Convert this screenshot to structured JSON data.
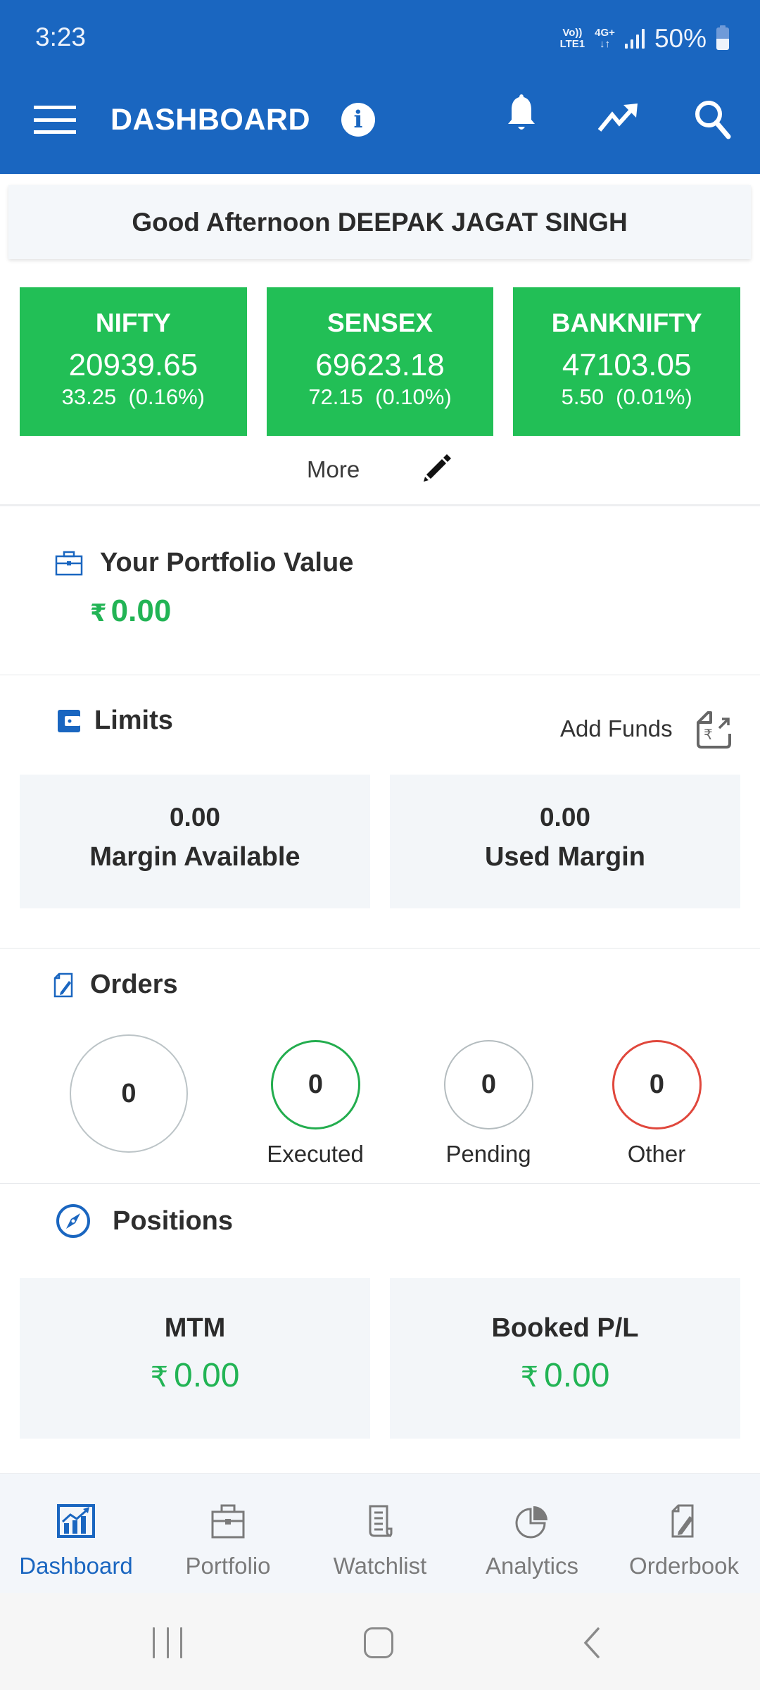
{
  "status_bar": {
    "time": "3:23",
    "net_top_left": "Vo))",
    "net_bottom_left": "LTE1",
    "net_top_right": "4G+",
    "net_bottom_right": "↓↑",
    "battery": "50%"
  },
  "app_bar": {
    "title": "DASHBOARD",
    "info_glyph": "i",
    "icons": [
      "menu-icon",
      "info-icon",
      "bell-icon",
      "trending-up-icon",
      "search-icon"
    ]
  },
  "greeting": "Good Afternoon DEEPAK JAGAT SINGH",
  "indices": [
    {
      "name": "NIFTY",
      "value": "20939.65",
      "change": "33.25  (0.16%)"
    },
    {
      "name": "SENSEX",
      "value": "69623.18",
      "change": "72.15  (0.10%)"
    },
    {
      "name": "BANKNIFTY",
      "value": "47103.05",
      "change": "5.50  (0.01%)"
    }
  ],
  "more_label": "More",
  "portfolio": {
    "title": "Your Portfolio Value",
    "currency": "₹",
    "value": "0.00"
  },
  "limits": {
    "title": "Limits",
    "add_funds_label": "Add Funds",
    "cards": [
      {
        "value": "0.00",
        "label": "Margin Available"
      },
      {
        "value": "0.00",
        "label": "Used Margin"
      }
    ]
  },
  "orders": {
    "title": "Orders",
    "total": "0",
    "executed": {
      "count": "0",
      "label": "Executed"
    },
    "pending": {
      "count": "0",
      "label": "Pending"
    },
    "other": {
      "count": "0",
      "label": "Other"
    }
  },
  "positions": {
    "title": "Positions",
    "currency": "₹",
    "cards": [
      {
        "label": "MTM",
        "value": "0.00"
      },
      {
        "label": "Booked P/L",
        "value": "0.00"
      }
    ]
  },
  "bottom_nav": {
    "active": "Dashboard",
    "tabs": [
      {
        "label": "Dashboard",
        "icon": "chart-icon"
      },
      {
        "label": "Portfolio",
        "icon": "briefcase-icon"
      },
      {
        "label": "Watchlist",
        "icon": "list-document-icon"
      },
      {
        "label": "Analytics",
        "icon": "pie-chart-icon"
      },
      {
        "label": "Orderbook",
        "icon": "edit-document-icon"
      }
    ]
  },
  "colors": {
    "primary": "#1a66c0",
    "index_green": "#22bf56",
    "value_green": "#22b455",
    "executed_green": "#23ad4e",
    "other_red": "#e0473c",
    "pending_gray": "#b4bcbf",
    "card_bg": "#f3f6f9"
  }
}
